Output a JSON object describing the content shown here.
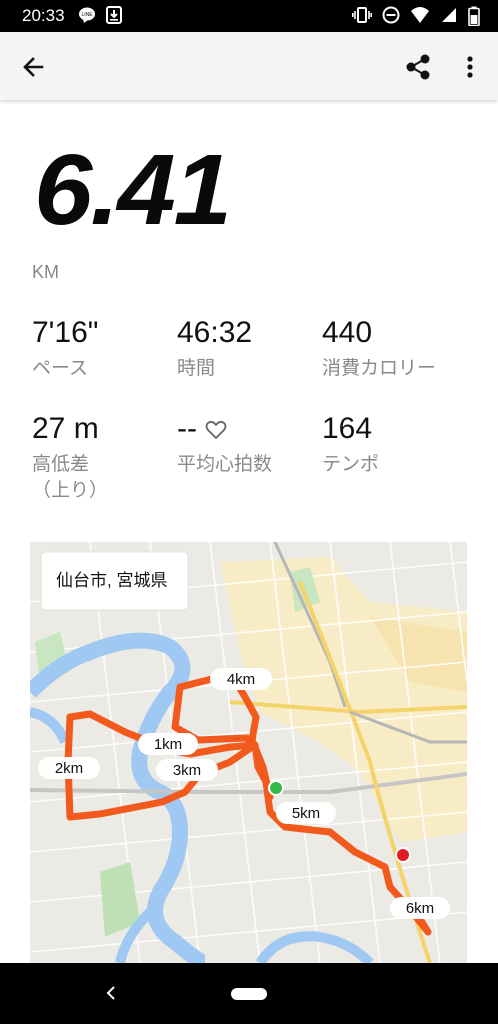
{
  "status_bar": {
    "time": "20:33",
    "left_icons": [
      "line-icon",
      "download-icon"
    ],
    "right_icons": [
      "vibrate-icon",
      "do-not-disturb-icon",
      "wifi-icon",
      "signal-icon",
      "battery-icon"
    ]
  },
  "app_bar": {
    "back_icon": "arrow-back-icon",
    "share_icon": "share-icon",
    "more_icon": "more-vert-icon"
  },
  "summary": {
    "distance": "6.41",
    "unit": "KM"
  },
  "stats": [
    {
      "value": "7'16\"",
      "label": "ペース"
    },
    {
      "value": "46:32",
      "label": "時間"
    },
    {
      "value": "440",
      "label": "消費カロリー"
    },
    {
      "value": "27 m",
      "label": "高低差",
      "label2": "（上り）"
    },
    {
      "value": "--",
      "label": "平均心拍数"
    },
    {
      "value": "164",
      "label": "テンポ"
    }
  ],
  "map": {
    "location": "仙台市, 宮城県",
    "route_color": "#f25a1d",
    "start_color": "#34b84a",
    "end_color": "#e21b24",
    "markers": [
      {
        "label": "1km"
      },
      {
        "label": "2km"
      },
      {
        "label": "3km"
      },
      {
        "label": "4km"
      },
      {
        "label": "5km"
      },
      {
        "label": "6km"
      }
    ]
  },
  "nav_bar": {
    "back_icon": "nav-back-icon",
    "home_icon": "home-pill-icon"
  }
}
